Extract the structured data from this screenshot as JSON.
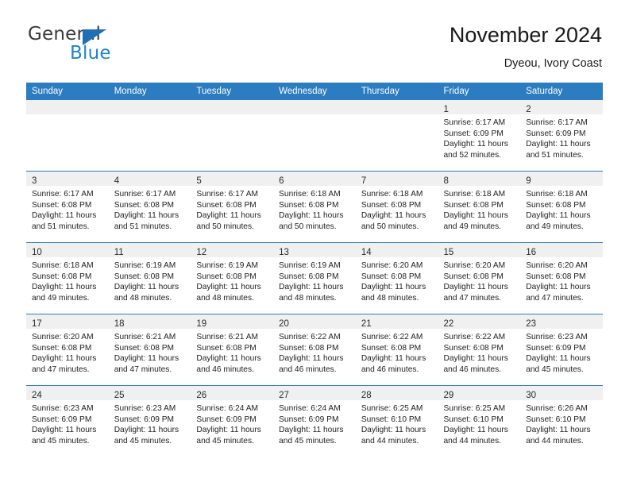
{
  "brand": {
    "name_top": "General",
    "name_bottom": "Blue",
    "accent_color": "#1b84d0",
    "triangle_color": "#1f6fb5"
  },
  "header": {
    "title": "November 2024",
    "location": "Dyeou, Ivory Coast"
  },
  "calendar": {
    "header_bg": "#2b7cc0",
    "daynum_bg": "#f0f0f0",
    "weekday_headers": [
      "Sunday",
      "Monday",
      "Tuesday",
      "Wednesday",
      "Thursday",
      "Friday",
      "Saturday"
    ],
    "weeks": [
      [
        {
          "empty": true
        },
        {
          "empty": true
        },
        {
          "empty": true
        },
        {
          "empty": true
        },
        {
          "empty": true
        },
        {
          "day": "1",
          "sunrise": "Sunrise: 6:17 AM",
          "sunset": "Sunset: 6:09 PM",
          "daylight1": "Daylight: 11 hours",
          "daylight2": "and 52 minutes."
        },
        {
          "day": "2",
          "sunrise": "Sunrise: 6:17 AM",
          "sunset": "Sunset: 6:09 PM",
          "daylight1": "Daylight: 11 hours",
          "daylight2": "and 51 minutes."
        }
      ],
      [
        {
          "day": "3",
          "sunrise": "Sunrise: 6:17 AM",
          "sunset": "Sunset: 6:08 PM",
          "daylight1": "Daylight: 11 hours",
          "daylight2": "and 51 minutes."
        },
        {
          "day": "4",
          "sunrise": "Sunrise: 6:17 AM",
          "sunset": "Sunset: 6:08 PM",
          "daylight1": "Daylight: 11 hours",
          "daylight2": "and 51 minutes."
        },
        {
          "day": "5",
          "sunrise": "Sunrise: 6:17 AM",
          "sunset": "Sunset: 6:08 PM",
          "daylight1": "Daylight: 11 hours",
          "daylight2": "and 50 minutes."
        },
        {
          "day": "6",
          "sunrise": "Sunrise: 6:18 AM",
          "sunset": "Sunset: 6:08 PM",
          "daylight1": "Daylight: 11 hours",
          "daylight2": "and 50 minutes."
        },
        {
          "day": "7",
          "sunrise": "Sunrise: 6:18 AM",
          "sunset": "Sunset: 6:08 PM",
          "daylight1": "Daylight: 11 hours",
          "daylight2": "and 50 minutes."
        },
        {
          "day": "8",
          "sunrise": "Sunrise: 6:18 AM",
          "sunset": "Sunset: 6:08 PM",
          "daylight1": "Daylight: 11 hours",
          "daylight2": "and 49 minutes."
        },
        {
          "day": "9",
          "sunrise": "Sunrise: 6:18 AM",
          "sunset": "Sunset: 6:08 PM",
          "daylight1": "Daylight: 11 hours",
          "daylight2": "and 49 minutes."
        }
      ],
      [
        {
          "day": "10",
          "sunrise": "Sunrise: 6:18 AM",
          "sunset": "Sunset: 6:08 PM",
          "daylight1": "Daylight: 11 hours",
          "daylight2": "and 49 minutes."
        },
        {
          "day": "11",
          "sunrise": "Sunrise: 6:19 AM",
          "sunset": "Sunset: 6:08 PM",
          "daylight1": "Daylight: 11 hours",
          "daylight2": "and 48 minutes."
        },
        {
          "day": "12",
          "sunrise": "Sunrise: 6:19 AM",
          "sunset": "Sunset: 6:08 PM",
          "daylight1": "Daylight: 11 hours",
          "daylight2": "and 48 minutes."
        },
        {
          "day": "13",
          "sunrise": "Sunrise: 6:19 AM",
          "sunset": "Sunset: 6:08 PM",
          "daylight1": "Daylight: 11 hours",
          "daylight2": "and 48 minutes."
        },
        {
          "day": "14",
          "sunrise": "Sunrise: 6:20 AM",
          "sunset": "Sunset: 6:08 PM",
          "daylight1": "Daylight: 11 hours",
          "daylight2": "and 48 minutes."
        },
        {
          "day": "15",
          "sunrise": "Sunrise: 6:20 AM",
          "sunset": "Sunset: 6:08 PM",
          "daylight1": "Daylight: 11 hours",
          "daylight2": "and 47 minutes."
        },
        {
          "day": "16",
          "sunrise": "Sunrise: 6:20 AM",
          "sunset": "Sunset: 6:08 PM",
          "daylight1": "Daylight: 11 hours",
          "daylight2": "and 47 minutes."
        }
      ],
      [
        {
          "day": "17",
          "sunrise": "Sunrise: 6:20 AM",
          "sunset": "Sunset: 6:08 PM",
          "daylight1": "Daylight: 11 hours",
          "daylight2": "and 47 minutes."
        },
        {
          "day": "18",
          "sunrise": "Sunrise: 6:21 AM",
          "sunset": "Sunset: 6:08 PM",
          "daylight1": "Daylight: 11 hours",
          "daylight2": "and 47 minutes."
        },
        {
          "day": "19",
          "sunrise": "Sunrise: 6:21 AM",
          "sunset": "Sunset: 6:08 PM",
          "daylight1": "Daylight: 11 hours",
          "daylight2": "and 46 minutes."
        },
        {
          "day": "20",
          "sunrise": "Sunrise: 6:22 AM",
          "sunset": "Sunset: 6:08 PM",
          "daylight1": "Daylight: 11 hours",
          "daylight2": "and 46 minutes."
        },
        {
          "day": "21",
          "sunrise": "Sunrise: 6:22 AM",
          "sunset": "Sunset: 6:08 PM",
          "daylight1": "Daylight: 11 hours",
          "daylight2": "and 46 minutes."
        },
        {
          "day": "22",
          "sunrise": "Sunrise: 6:22 AM",
          "sunset": "Sunset: 6:08 PM",
          "daylight1": "Daylight: 11 hours",
          "daylight2": "and 46 minutes."
        },
        {
          "day": "23",
          "sunrise": "Sunrise: 6:23 AM",
          "sunset": "Sunset: 6:09 PM",
          "daylight1": "Daylight: 11 hours",
          "daylight2": "and 45 minutes."
        }
      ],
      [
        {
          "day": "24",
          "sunrise": "Sunrise: 6:23 AM",
          "sunset": "Sunset: 6:09 PM",
          "daylight1": "Daylight: 11 hours",
          "daylight2": "and 45 minutes."
        },
        {
          "day": "25",
          "sunrise": "Sunrise: 6:23 AM",
          "sunset": "Sunset: 6:09 PM",
          "daylight1": "Daylight: 11 hours",
          "daylight2": "and 45 minutes."
        },
        {
          "day": "26",
          "sunrise": "Sunrise: 6:24 AM",
          "sunset": "Sunset: 6:09 PM",
          "daylight1": "Daylight: 11 hours",
          "daylight2": "and 45 minutes."
        },
        {
          "day": "27",
          "sunrise": "Sunrise: 6:24 AM",
          "sunset": "Sunset: 6:09 PM",
          "daylight1": "Daylight: 11 hours",
          "daylight2": "and 45 minutes."
        },
        {
          "day": "28",
          "sunrise": "Sunrise: 6:25 AM",
          "sunset": "Sunset: 6:10 PM",
          "daylight1": "Daylight: 11 hours",
          "daylight2": "and 44 minutes."
        },
        {
          "day": "29",
          "sunrise": "Sunrise: 6:25 AM",
          "sunset": "Sunset: 6:10 PM",
          "daylight1": "Daylight: 11 hours",
          "daylight2": "and 44 minutes."
        },
        {
          "day": "30",
          "sunrise": "Sunrise: 6:26 AM",
          "sunset": "Sunset: 6:10 PM",
          "daylight1": "Daylight: 11 hours",
          "daylight2": "and 44 minutes."
        }
      ]
    ]
  }
}
